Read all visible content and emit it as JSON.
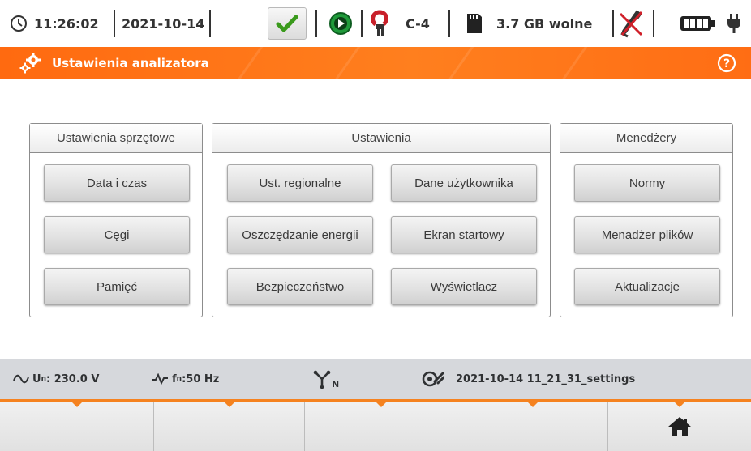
{
  "status_bar": {
    "time": "11:26:02",
    "date": "2021-10-14",
    "clamp_label": "C-4",
    "memory_free": "3.7 GB wolne",
    "icons": [
      "clock-icon",
      "ok-check-icon",
      "play-icon",
      "clamp-icon",
      "sd-card-icon",
      "usb-disconnected-icon",
      "battery-icon",
      "power-plug-icon"
    ]
  },
  "title_bar": {
    "title": "Ustawienia analizatora",
    "icons": [
      "gears-icon",
      "help-icon"
    ]
  },
  "panels": {
    "hardware": {
      "title": "Ustawienia sprzętowe",
      "buttons": [
        "Data i czas",
        "Cęgi",
        "Pamięć"
      ]
    },
    "settings": {
      "title": "Ustawienia",
      "buttons": [
        "Ust. regionalne",
        "Dane użytkownika",
        "Oszczędzanie energii",
        "Ekran startowy",
        "Bezpieczeństwo",
        "Wyświetlacz"
      ]
    },
    "managers": {
      "title": "Menedżery",
      "buttons": [
        "Normy",
        "Menadżer plików",
        "Aktualizacje"
      ]
    }
  },
  "info_bar": {
    "voltage": "U",
    "voltage_sub": "n",
    "voltage_value": ": 230.0 V",
    "frequency": "f",
    "frequency_sub": "n",
    "frequency_value": ":50 Hz",
    "network_symbol_sub": "N",
    "settings_file": "2021-10-14 11_21_31_settings"
  },
  "function_bar": {
    "keys": [
      "",
      "",
      "",
      "",
      "home-icon"
    ]
  },
  "colors": {
    "accent": "#f5821f",
    "title_bar": "#ff7418",
    "ok_green": "#3a9a1c",
    "play_green": "#1f9a3a",
    "clamp_red": "#c8202a"
  }
}
